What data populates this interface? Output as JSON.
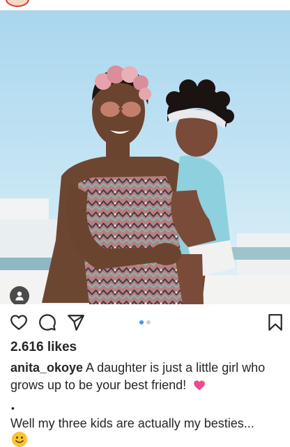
{
  "post": {
    "likes_text": "2.616 likes",
    "username": "anita_okoye",
    "caption_line1": " A daughter is just a little girl who grows up to be your best friend!",
    "bullet": "•",
    "caption_line2": "Well my three kids are actually my besties...",
    "carousel": {
      "total": 2,
      "current": 1
    }
  },
  "icons": {
    "tagged_user": "person-icon",
    "like": "heart-icon",
    "comment": "comment-icon",
    "share": "send-icon",
    "save": "bookmark-icon",
    "caption_emoji_1": "sparkling-heart-emoji",
    "caption_emoji_2": "smiling-face-emoji"
  },
  "colors": {
    "text": "#262626",
    "carousel_active": "#3897f0",
    "carousel_inactive": "#cfcfcf"
  }
}
